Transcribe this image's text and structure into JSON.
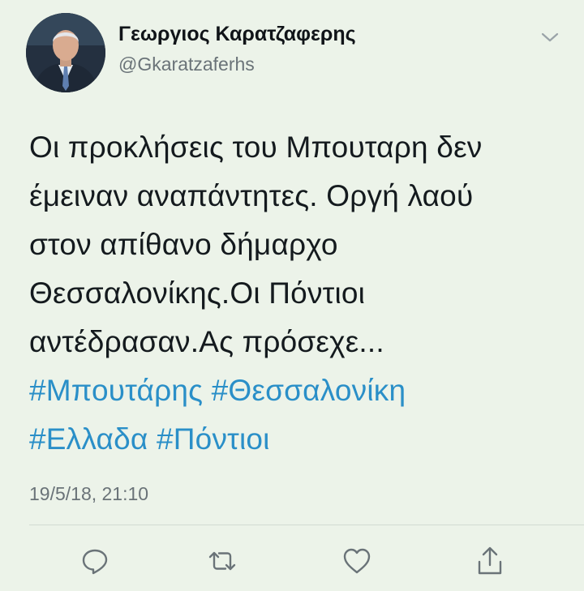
{
  "tweet": {
    "author": {
      "name": "Γεωργιος Καρατζαφερης",
      "handle": "@Gkaratzaferhs",
      "avatar_icon": "profile-photo"
    },
    "menu_icon": "chevron-down-icon",
    "text_lines": [
      "Οι προκλήσεις του Μπουταρη δεν",
      "έμειναν αναπάντητες. Οργή λαού",
      "στον απίθανο δήμαρχο",
      "Θεσσαλονίκης.Οι Πόντιοι",
      "αντέδρασαν.Ας πρόσεχε..."
    ],
    "hashtags": {
      "line1": [
        "#Μπουτάρης",
        "#Θεσσαλονίκη"
      ],
      "line2": [
        "#Ελλαδα",
        "#Πόντιοι"
      ]
    },
    "timestamp": "19/5/18, 21:10",
    "actions": {
      "reply_icon": "reply-icon",
      "retweet_icon": "retweet-icon",
      "like_icon": "heart-icon",
      "share_icon": "share-icon"
    },
    "colors": {
      "background": "#ecf3e9",
      "text": "#141a1e",
      "secondary": "#6a7378",
      "hashtag": "#2a8fc8"
    }
  }
}
